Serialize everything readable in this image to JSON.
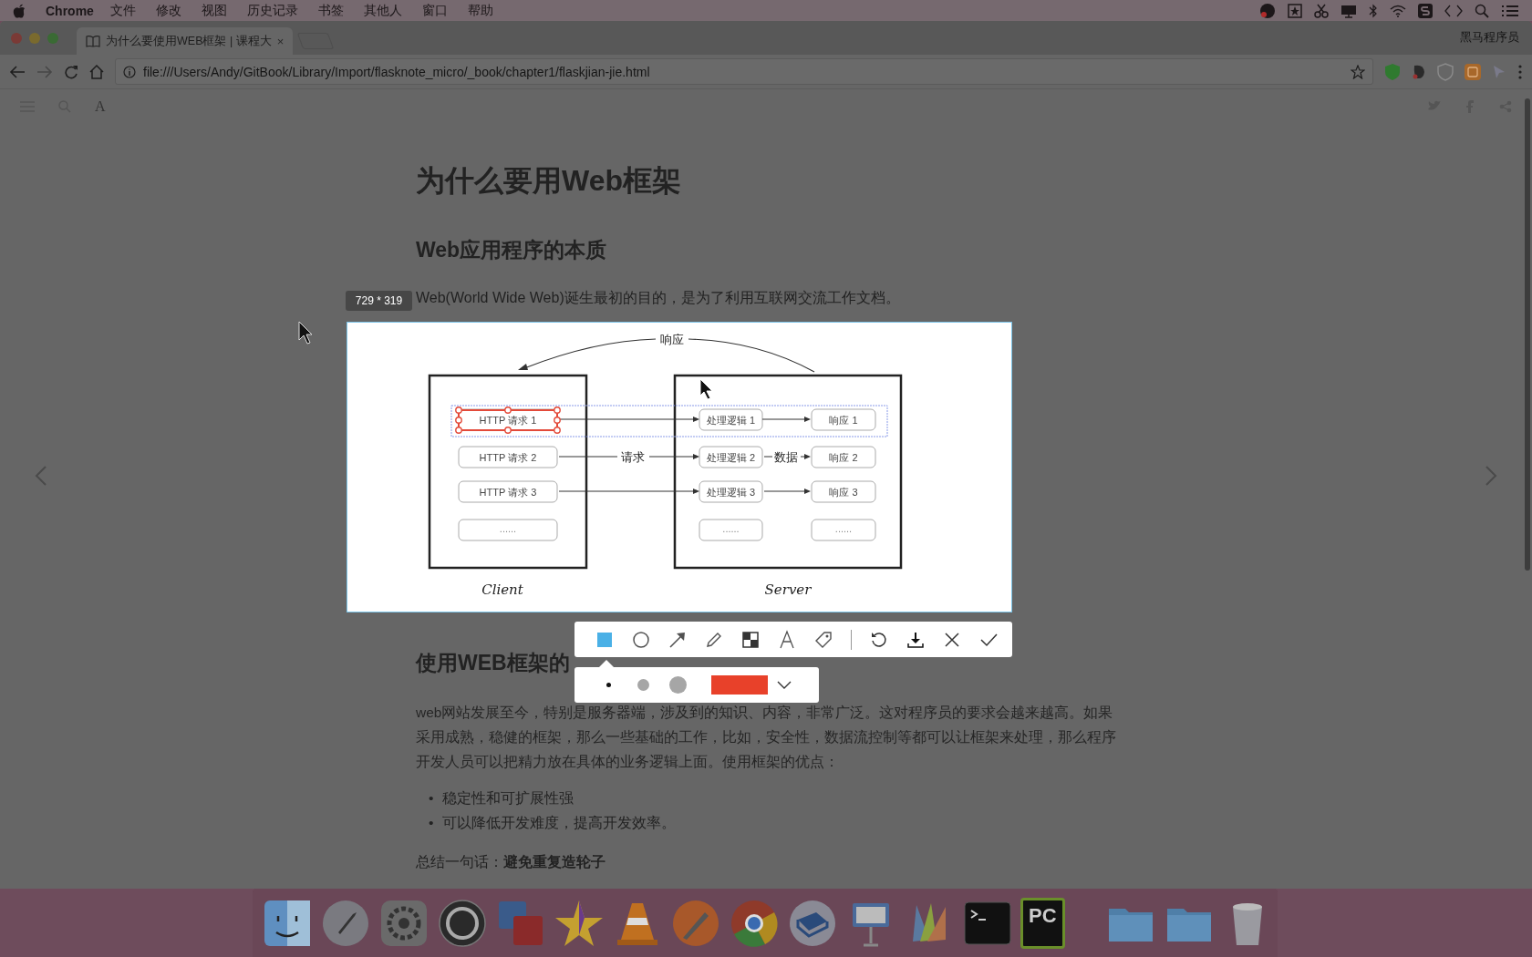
{
  "menu_bar": {
    "app": "Chrome",
    "items": [
      "文件",
      "修改",
      "视图",
      "历史记录",
      "书签",
      "其他人",
      "窗口",
      "帮助"
    ]
  },
  "browser": {
    "tab": {
      "title": "为什么要使用WEB框架 | 课程大",
      "close": "×"
    },
    "profile": "黑马程序员",
    "url": "file:///Users/Andy/GitBook/Library/Import/flasknote_micro/_book/chapter1/flaskjian-jie.html"
  },
  "book_toolbar": {
    "font_button": "A"
  },
  "article": {
    "title": "为什么要用Web框架",
    "heading_1": "Web应用程序的本质",
    "intro": "Web(World Wide Web)诞生最初的目的，是为了利用互联网交流工作文档。",
    "heading_2": "使用WEB框架的",
    "paragraph": "web网站发展至今，特别是服务器端，涉及到的知识、内容，非常广泛。这对程序员的要求会越来越高。如果采用成熟，稳健的框架，那么一些基础的工作，比如，安全性，数据流控制等都可以让框架来处理，那么程序开发人员可以把精力放在具体的业务逻辑上面。使用框架的优点：",
    "bullets": [
      {
        "marker": "•",
        "text": "稳定性和可扩展性强"
      },
      {
        "marker": "•",
        "text": "可以降低开发难度，提高开发效率。"
      }
    ],
    "summary": "总结一句话：**避免重复造轮子**"
  },
  "capture": {
    "size_label": "729 * 319",
    "diagram": {
      "top_label": "响应",
      "request_label": "请求",
      "data_label": "数据",
      "client_label": "Client",
      "server_label": "Server",
      "client_rows": [
        "HTTP 请求 1",
        "HTTP 请求 2",
        "HTTP 请求 3",
        "......"
      ],
      "logic_rows": [
        "处理逻辑 1",
        "处理逻辑 2",
        "处理逻辑 3",
        "......"
      ],
      "response_rows": [
        "响应 1",
        "响应 2",
        "响应 3",
        "......"
      ]
    },
    "tools": [
      {
        "kind": "rect",
        "selected": true
      },
      {
        "kind": "ellipse",
        "selected": false
      },
      {
        "kind": "arrow",
        "selected": false
      },
      {
        "kind": "pencil",
        "selected": false
      },
      {
        "kind": "mosaic",
        "selected": false
      },
      {
        "kind": "text",
        "selected": false
      },
      {
        "kind": "tag",
        "selected": false
      }
    ],
    "actions": [
      {
        "kind": "undo"
      },
      {
        "kind": "download"
      },
      {
        "kind": "cancel"
      },
      {
        "kind": "confirm"
      }
    ],
    "sizes": [
      {
        "kind": "small",
        "selected": true
      },
      {
        "kind": "medium",
        "selected": false
      },
      {
        "kind": "large",
        "selected": false
      }
    ],
    "color": "#e8412a"
  },
  "dock": {
    "ide_text": "PC"
  }
}
